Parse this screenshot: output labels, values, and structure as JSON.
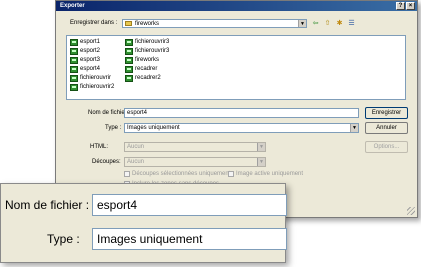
{
  "window": {
    "title": "Exporter",
    "help_glyph": "?",
    "close_glyph": "×"
  },
  "save_in": {
    "label": "Enregistrer dans :",
    "value": "fireworks"
  },
  "nav_icons": [
    {
      "name": "back-icon",
      "glyph": "⇦"
    },
    {
      "name": "up-folder-icon",
      "glyph": "⇧"
    },
    {
      "name": "new-folder-icon",
      "glyph": "✱"
    },
    {
      "name": "view-menu-icon",
      "glyph": "☰"
    }
  ],
  "files": {
    "column1": [
      "esport1",
      "esport2",
      "esport3",
      "esport4",
      "fichierouvrir",
      "fichierouvrir2"
    ],
    "column2": [
      "fichierouvrir3",
      "fichierouvrir3",
      "fireworks",
      "recadrer",
      "recadrer2"
    ]
  },
  "filename": {
    "label": "Nom de fichier :",
    "value": "esport4"
  },
  "type": {
    "label": "Type :",
    "value": "Images uniquement"
  },
  "html": {
    "label": "HTML:",
    "value": "Aucun"
  },
  "slices": {
    "label": "Découpes:",
    "value": "Aucun"
  },
  "checkboxes": {
    "selected_slices": "Découpes sélectionnées uniquement",
    "current_frame": "Image active uniquement",
    "include_areas": "Inclure les zones sans découpes"
  },
  "buttons": {
    "save": "Enregistrer",
    "cancel": "Annuler",
    "options": "Options..."
  },
  "dropdown_arrow": "▼",
  "zoom": {
    "filename_label": "Nom de fichier :",
    "filename_value": "esport4",
    "type_label": "Type :",
    "type_value": "Images uniquement"
  }
}
